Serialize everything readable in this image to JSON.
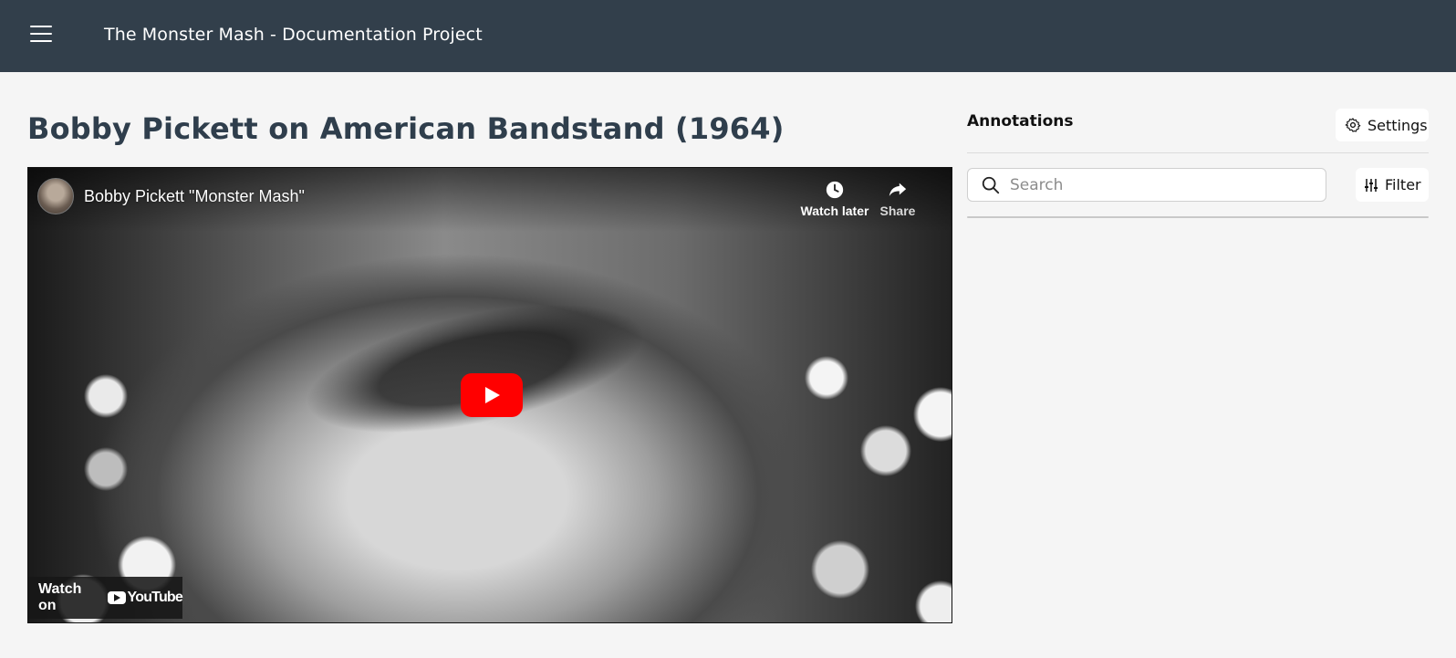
{
  "header": {
    "menu_icon": "hamburger-icon",
    "app_title": "The Monster Mash - Documentation Project"
  },
  "page": {
    "title": "Bobby Pickett on American Bandstand (1964)"
  },
  "video": {
    "title": "Bobby Pickett \"Monster Mash\"",
    "watch_later_label": "Watch later",
    "share_label": "Share",
    "watch_on_label": "Watch on",
    "platform_label": "YouTube",
    "play_color": "#ff0000"
  },
  "annotations": {
    "heading": "Annotations",
    "settings_label": "Settings",
    "search_placeholder": "Search",
    "filter_label": "Filter"
  },
  "colors": {
    "header_bg": "#323f4b",
    "page_bg": "#f5f5f5",
    "title_text": "#2f3e4c"
  }
}
